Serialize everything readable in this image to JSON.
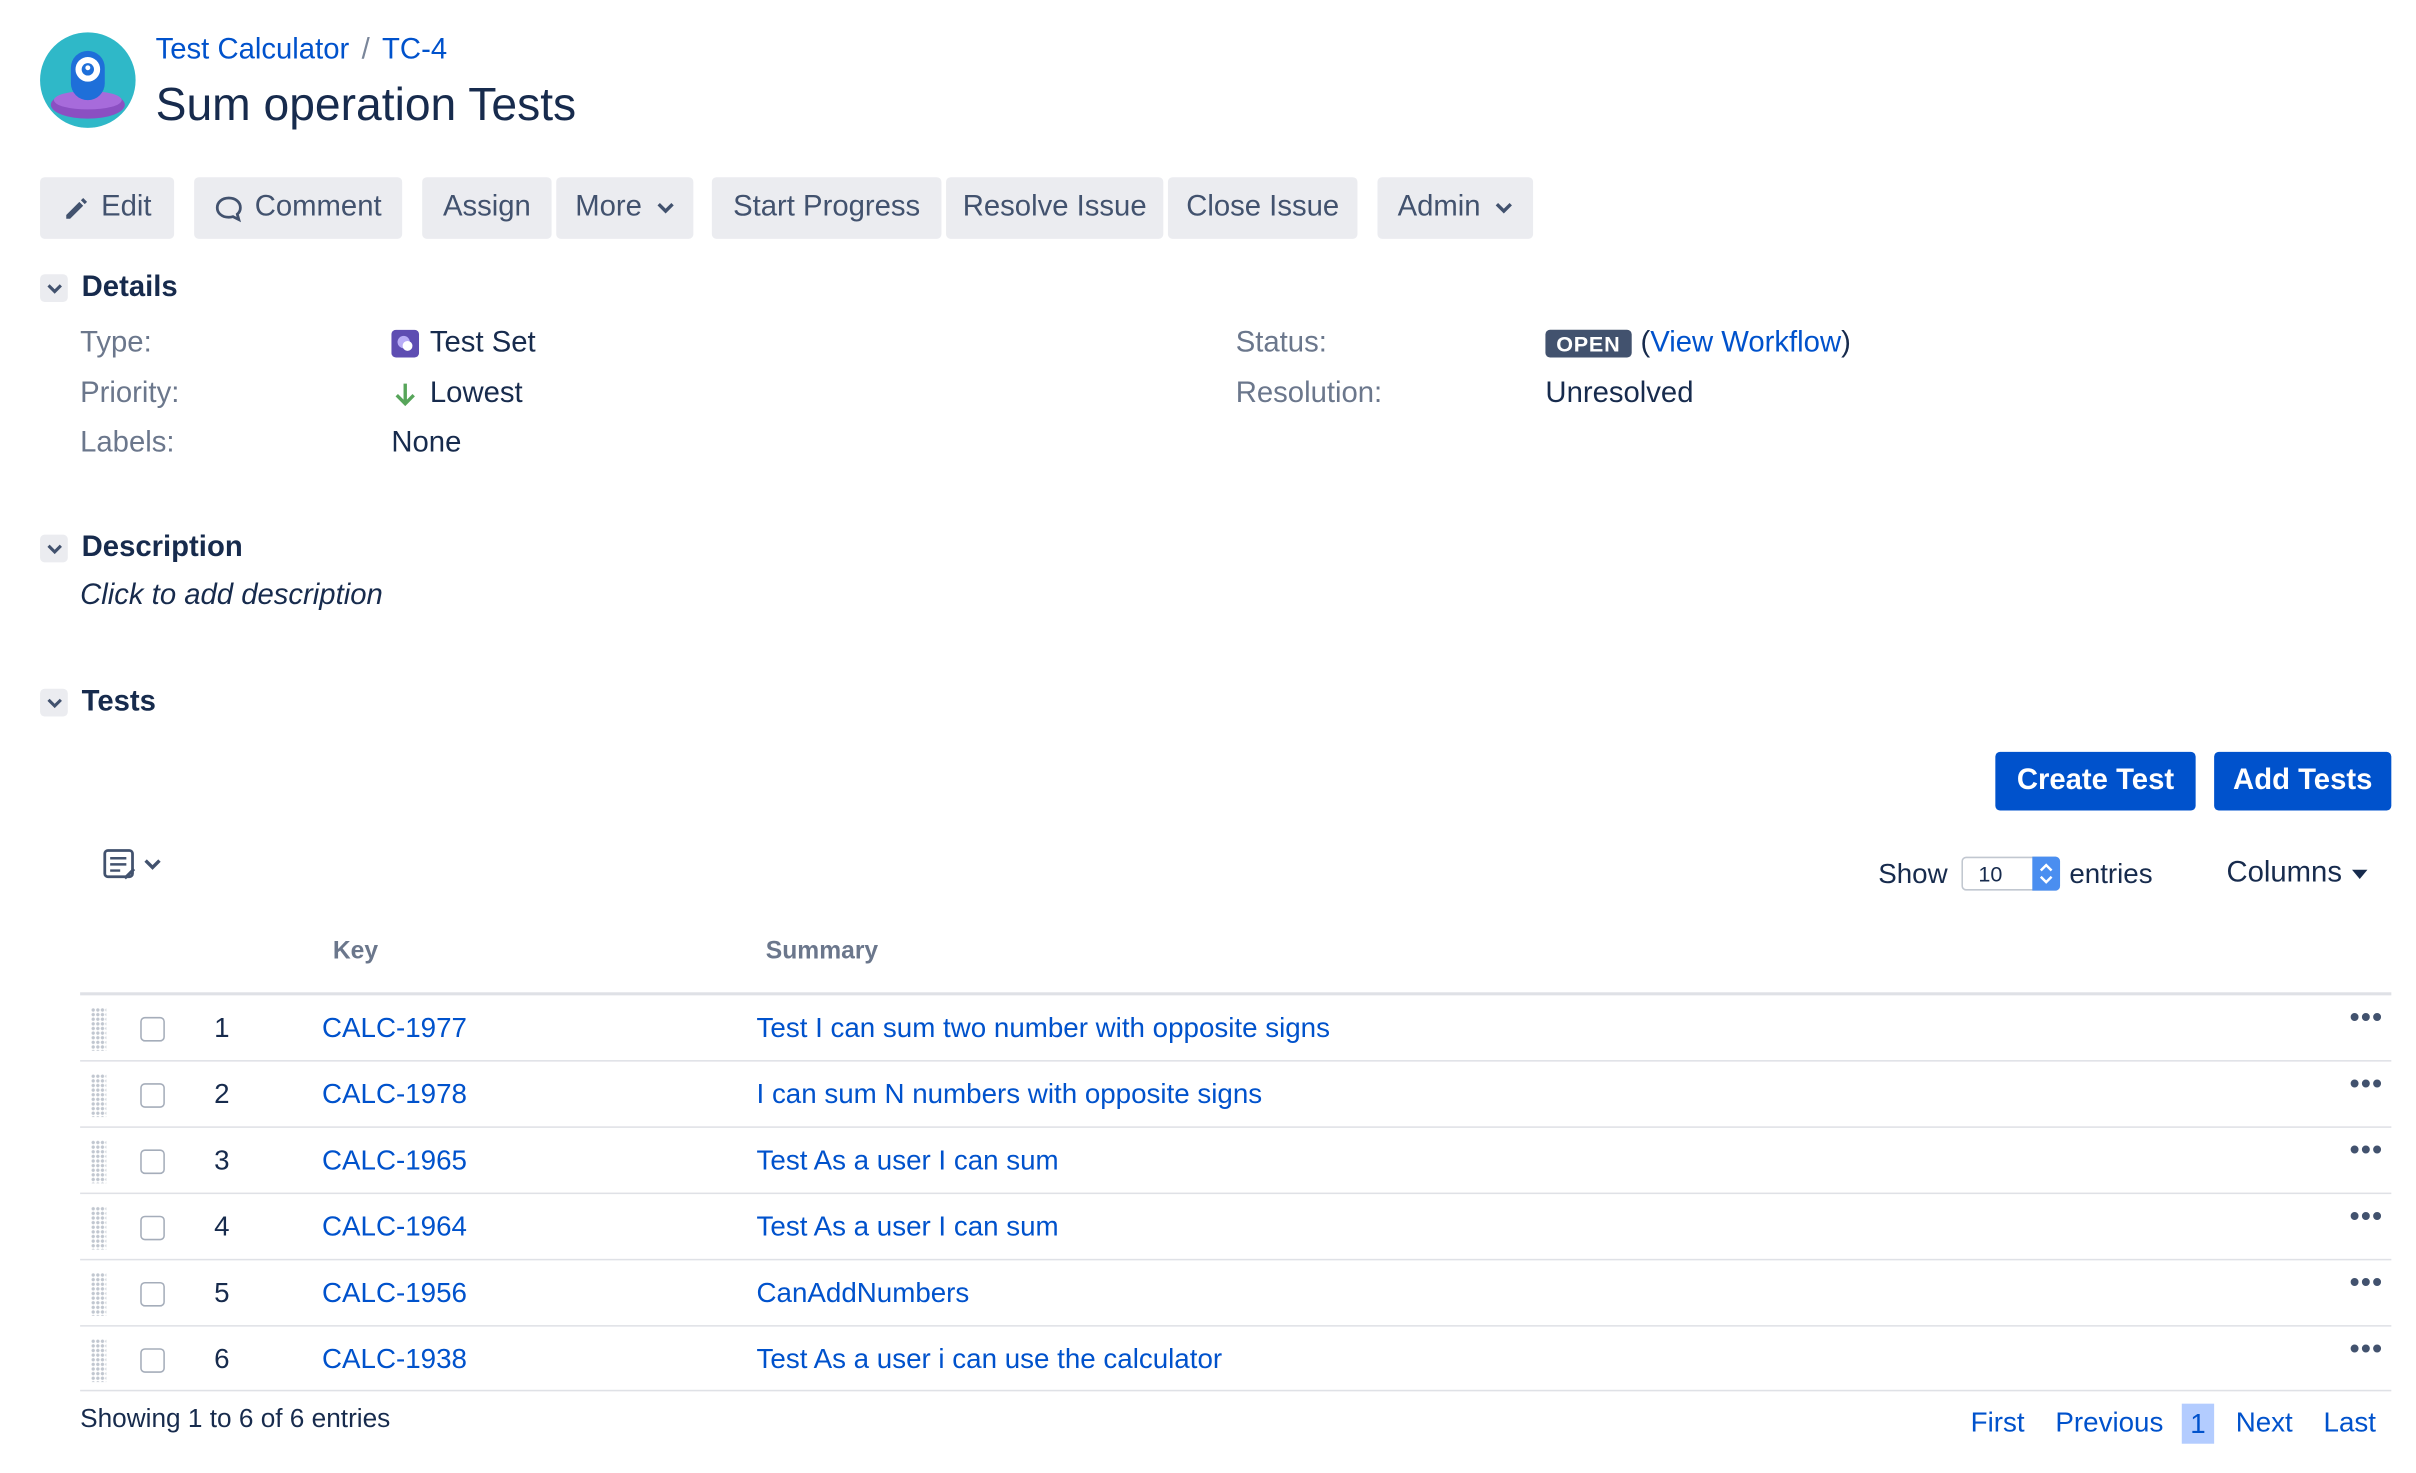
{
  "header": {
    "breadcrumbs": [
      {
        "label": "Test Calculator"
      },
      {
        "label": "TC-4"
      }
    ],
    "separator": "/",
    "title": "Sum operation Tests"
  },
  "toolbar": {
    "edit_label": "Edit",
    "comment_label": "Comment",
    "assign_label": "Assign",
    "more_label": "More",
    "start_progress_label": "Start Progress",
    "resolve_issue_label": "Resolve Issue",
    "close_issue_label": "Close Issue",
    "admin_label": "Admin"
  },
  "details": {
    "heading": "Details",
    "type_label": "Type:",
    "type_value": "Test Set",
    "priority_label": "Priority:",
    "priority_value": "Lowest",
    "labels_label": "Labels:",
    "labels_value": "None",
    "status_label": "Status:",
    "status_value": "OPEN",
    "view_workflow_open": "(",
    "view_workflow_label": "View Workflow",
    "view_workflow_close": ")",
    "resolution_label": "Resolution:",
    "resolution_value": "Unresolved"
  },
  "description": {
    "heading": "Description",
    "placeholder": "Click to add description"
  },
  "tests": {
    "heading": "Tests",
    "create_test_label": "Create Test",
    "add_tests_label": "Add Tests",
    "show_label": "Show",
    "entries_value": "10",
    "entries_label": "entries",
    "columns_label": "Columns",
    "columns": [
      "Key",
      "Summary"
    ],
    "rows": [
      {
        "num": "1",
        "key": "CALC-1977",
        "summary": "Test I can sum two number with opposite signs"
      },
      {
        "num": "2",
        "key": "CALC-1978",
        "summary": "I can sum N numbers with opposite signs"
      },
      {
        "num": "3",
        "key": "CALC-1965",
        "summary": "Test As a user I can sum"
      },
      {
        "num": "4",
        "key": "CALC-1964",
        "summary": "Test As a user I can sum"
      },
      {
        "num": "5",
        "key": "CALC-1956",
        "summary": "CanAddNumbers"
      },
      {
        "num": "6",
        "key": "CALC-1938",
        "summary": "Test As a user i can use the calculator"
      }
    ],
    "row_menu": "•••",
    "showing_text": "Showing 1 to 6 of 6 entries",
    "pagination": {
      "first": "First",
      "previous": "Previous",
      "current": "1",
      "next": "Next",
      "last": "Last"
    }
  },
  "icons": {
    "project_avatar": "project-avatar",
    "edit": "pencil-icon",
    "comment": "comment-icon",
    "dropdown": "chevron-down-icon",
    "type": "test-set-icon",
    "priority": "arrow-down-icon",
    "table_settings": "table-settings-icon",
    "drag": "drag-handle-icon",
    "row_actions": "more-actions-icon"
  },
  "colors": {
    "link": "#0052cc",
    "primary_button": "#0052cc",
    "toolbar_button": "#ebecf0",
    "status_lozenge": "#42526e",
    "priority_lowest": "#57a55a",
    "avatar_bg": "#2fb8c8"
  }
}
